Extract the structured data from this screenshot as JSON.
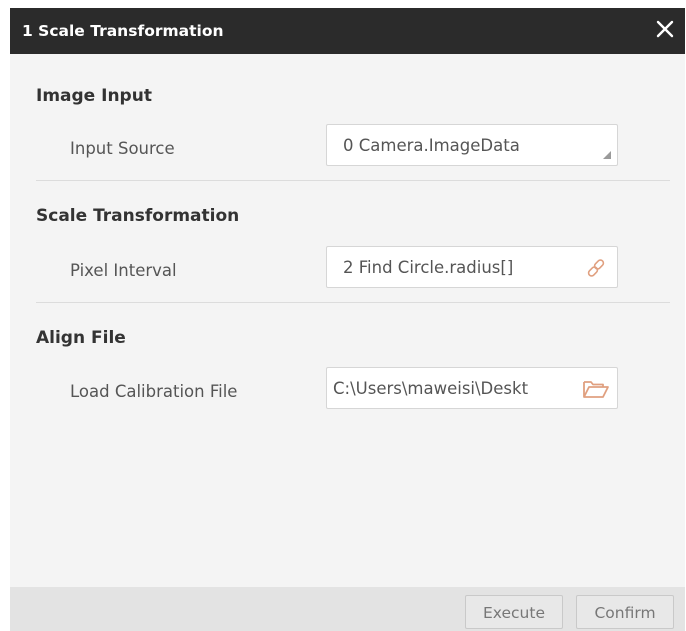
{
  "dialog": {
    "title": "1 Scale Transformation"
  },
  "sections": [
    {
      "title": "Image Input",
      "label": "Input Source",
      "value": "0 Camera.ImageData",
      "icon": "dropdown-corner-icon"
    },
    {
      "title": "Scale Transformation",
      "label": "Pixel Interval",
      "value": "2 Find Circle.radius[]",
      "icon": "link-icon"
    },
    {
      "title": "Align File",
      "label": "Load Calibration File",
      "value": "C:\\Users\\maweisi\\Deskt",
      "icon": "folder-open-icon"
    }
  ],
  "footer": {
    "execute_label": "Execute",
    "confirm_label": "Confirm"
  },
  "colors": {
    "titlebar": "#2b2b2b",
    "icon_accent": "#e0a080",
    "panel": "#f4f4f4",
    "footer": "#e3e3e3"
  }
}
